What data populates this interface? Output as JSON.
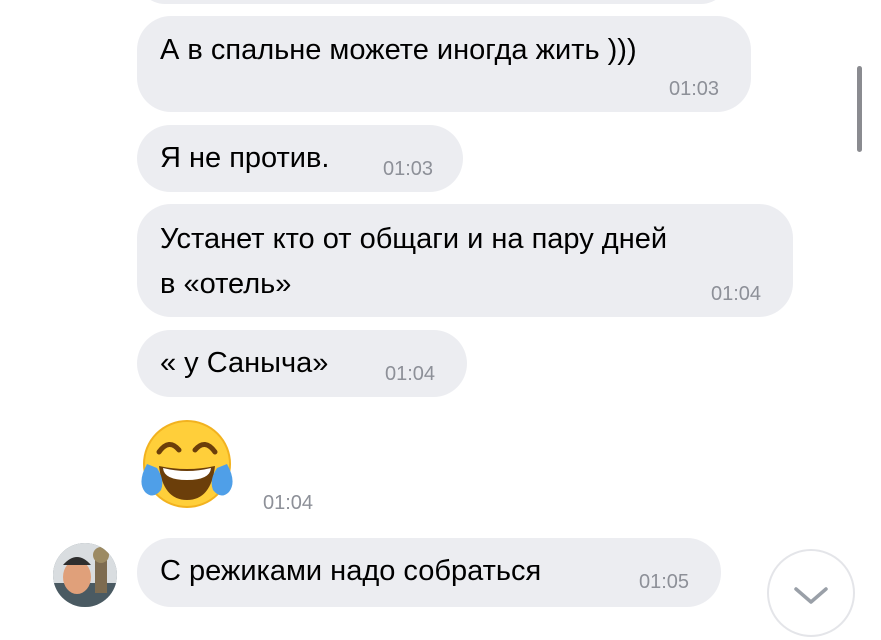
{
  "messages": [
    {
      "text": "А в спальне можете иногда жить )))",
      "time": "01:03"
    },
    {
      "text": "Я не против.",
      "time": "01:03"
    },
    {
      "line1": "Устанет кто от общаги и на пару дней",
      "line2": "в «отель»",
      "time": "01:04"
    },
    {
      "text": "« у Саныча»",
      "time": "01:04"
    },
    {
      "emoji": "face-with-tears-of-joy-icon",
      "time": "01:04"
    },
    {
      "text": "С режиками надо собраться",
      "time": "01:05"
    }
  ],
  "icons": {
    "scroll_down": "chevron-down-icon",
    "avatar": "sender-avatar"
  },
  "colors": {
    "bubble": "#ecedf1",
    "time": "#8d9098",
    "emoji_face": "#ffcf3a",
    "tears": "#4f9fe8"
  }
}
